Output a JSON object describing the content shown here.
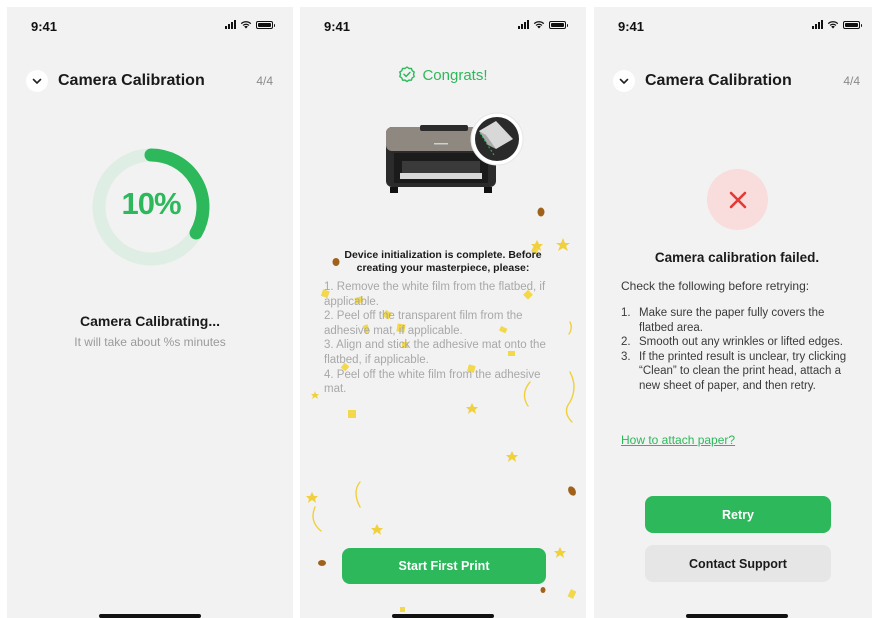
{
  "status": {
    "time": "9:41"
  },
  "calibrating_screen": {
    "header_title": "Camera Calibration",
    "step": "4/4",
    "progress_percent": 10,
    "progress_label": "10%",
    "title": "Camera Calibrating...",
    "subtitle": "It will take about %s minutes"
  },
  "congrats_screen": {
    "congrats_text": "Congrats!",
    "heading": "Device initialization is complete. Before creating your masterpiece, please:",
    "steps": [
      "1. Remove the white film from the flatbed, if applicable.",
      "2. Peel off the transparent film from the adhesive mat, if applicable.",
      "3. Align and stick the adhesive mat onto the flatbed, if applicable.",
      "4. Peel off the white film from the adhesive mat."
    ],
    "button_label": "Start First Print"
  },
  "failed_screen": {
    "header_title": "Camera Calibration",
    "step": "4/4",
    "title": "Camera calibration failed.",
    "check_intro": "Check the following before retrying:",
    "list": [
      {
        "num": "1.",
        "text": "Make sure the paper fully covers the flatbed area."
      },
      {
        "num": "2.",
        "text": "Smooth out any wrinkles or lifted edges."
      },
      {
        "num": "3.",
        "text": "If the printed result is unclear, try clicking “Clean” to clean the print head, attach a new sheet of paper, and then retry."
      }
    ],
    "link_text": "How to attach paper?",
    "retry_label": "Retry",
    "support_label": "Contact Support"
  },
  "colors": {
    "accent_green": "#2db85b",
    "error_red": "#e53935",
    "error_bg": "#f9dcdc",
    "screen_bg": "#f2f2f2"
  },
  "icons": [
    "chevron-down-icon",
    "signal-icon",
    "wifi-icon",
    "battery-icon",
    "award-badge-icon",
    "close-x-icon",
    "printer-illustration"
  ]
}
